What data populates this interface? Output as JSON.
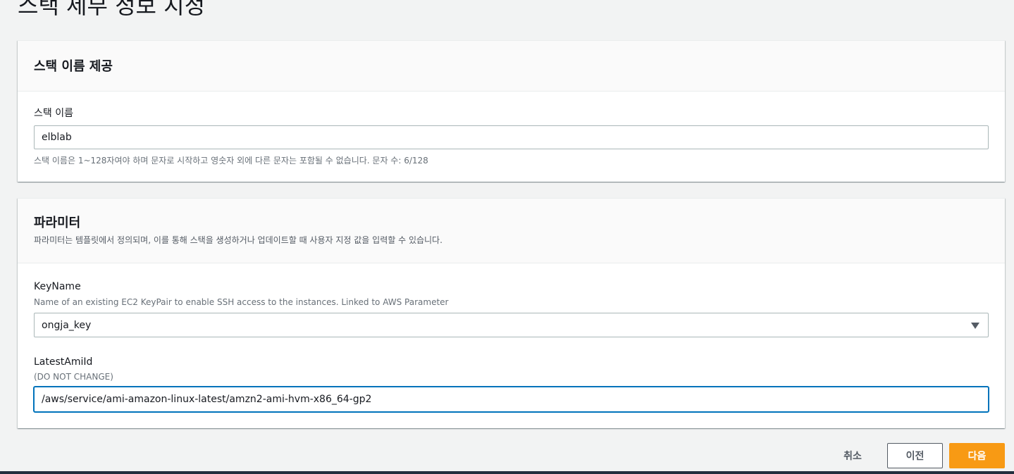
{
  "page": {
    "title": "스택 세부 정보 지정"
  },
  "stack_name_panel": {
    "title": "스택 이름 제공",
    "field_label": "스택 이름",
    "value": "elblab",
    "hint": "스택 이름은 1~128자여야 하며 문자로 시작하고 영숫자 외에 다른 문자는 포함될 수 없습니다. 문자 수: 6/128"
  },
  "parameters_panel": {
    "title": "파라미터",
    "description": "파라미터는 템플릿에서 정의되며, 이를 통해 스택을 생성하거나 업데이트할 때 사용자 지정 값을 입력할 수 있습니다.",
    "keyname": {
      "label": "KeyName",
      "description": "Name of an existing EC2 KeyPair to enable SSH access to the instances. Linked to AWS Parameter",
      "selected": "ongja_key"
    },
    "latest_ami": {
      "label": "LatestAmiId",
      "description": "(DO NOT CHANGE)",
      "value": "/aws/service/ami-amazon-linux-latest/amzn2-ami-hvm-x86_64-gp2"
    }
  },
  "actions": {
    "cancel": "취소",
    "previous": "이전",
    "next": "다음"
  },
  "colors": {
    "background": "#f2f3f3",
    "primary_button": "#f89a14",
    "focus_border": "#0073bb",
    "bottom_bar": "#232f3e"
  }
}
